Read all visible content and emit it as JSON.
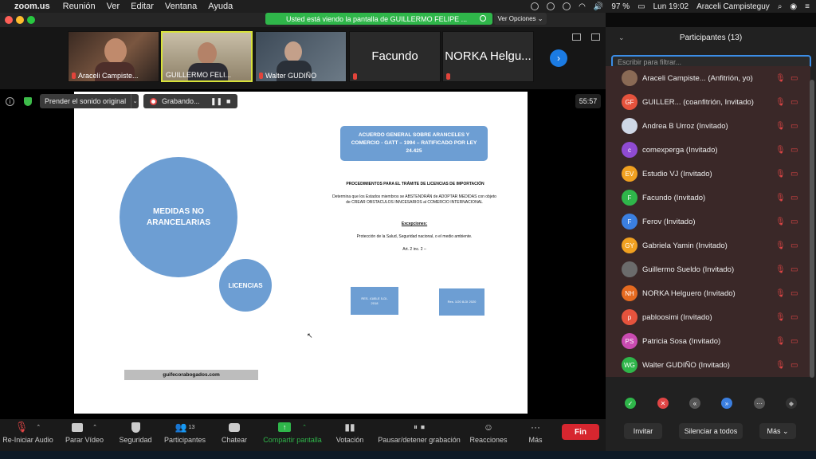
{
  "menubar": {
    "app": "zoom.us",
    "items": [
      "Reunión",
      "Ver",
      "Editar",
      "Ventana",
      "Ayuda"
    ],
    "battery": "97 %",
    "clock": "Lun 19:02",
    "user": "Araceli Campisteguy"
  },
  "share_banner": {
    "text": "Usted está viendo la pantalla de GUILLERMO FELIPE ...",
    "view_options": "Ver Opciones"
  },
  "gallery": [
    {
      "name": "Araceli Campiste..."
    },
    {
      "name": "GUILLERMO FELI..."
    },
    {
      "name": "Walter GUDIÑO"
    },
    {
      "name": "Facundo",
      "big": "Facundo"
    },
    {
      "name": "NORKA Helgu...",
      "big": "NORKA Helgu..."
    }
  ],
  "stage": {
    "original_sound": "Prender el sonido original",
    "recording": "Grabando...",
    "timer": "55:57"
  },
  "slide": {
    "big_circle": "MEDIDAS NO ARANCELARIAS",
    "small_circle": "LICENCIAS",
    "title": "ACUERDO GENERAL SOBRE ARANCELES Y COMERCIO - GATT – 1994 – RATIFICADO POR LEY 24.425",
    "heading": "PROCEDIMIENTOS PARA EL TRÁMITE DE LICENCIAS DE IMPORTACIÓN",
    "body": "Determina que los Estados miembros se ABSTENDRÁN de ADOPTAR MEDIDAS con objeto de CREAR OBSTACULOS INNCESARIOS al COMERCIO INTERNACIONAL",
    "exceptions_label": "Excepciones:",
    "exceptions": "Protección de la Salud, Seguridad nacional, o el medio ambiente.",
    "article": "Art. 2 inc. 2 –",
    "res1": "RES. 4185-E 5-DI-2018",
    "res2": "Res. 1/20 8-DI 2020",
    "url": "guifecorabogados.com"
  },
  "toolbar": {
    "audio": "Re-Iniciar Audio",
    "video": "Parar Vídeo",
    "security": "Seguridad",
    "participants": "Participantes",
    "participants_count": "13",
    "chat": "Chatear",
    "share": "Compartir pantalla",
    "poll": "Votación",
    "record": "Pausar/detener grabación",
    "reactions": "Reacciones",
    "more": "Más",
    "end": "Fin"
  },
  "panel": {
    "title": "Participantes (13)",
    "filter_placeholder": "Escribir para filtrar...",
    "participants": [
      {
        "initials": "",
        "name": "Araceli Campiste... (Anfitrión, yo)",
        "color": "#8a6a55"
      },
      {
        "initials": "GF",
        "name": "GUILLER... (coanfitrión, Invitado)",
        "color": "#e5533d"
      },
      {
        "initials": "",
        "name": "Andrea B Urroz (Invitado)",
        "color": "#cfd8e6"
      },
      {
        "initials": "c",
        "name": "comexperga (Invitado)",
        "color": "#8f4bd1"
      },
      {
        "initials": "EV",
        "name": "Estudio VJ (Invitado)",
        "color": "#f0a020"
      },
      {
        "initials": "F",
        "name": "Facundo (Invitado)",
        "color": "#2fb64a"
      },
      {
        "initials": "F",
        "name": "Ferov (Invitado)",
        "color": "#3b7fe0"
      },
      {
        "initials": "GY",
        "name": "Gabriela Yamin (Invitado)",
        "color": "#f0a020"
      },
      {
        "initials": "",
        "name": "Guillermo Sueldo (Invitado)",
        "color": "#6b6b6b"
      },
      {
        "initials": "NH",
        "name": "NORKA Helguero (Invitado)",
        "color": "#e56a20"
      },
      {
        "initials": "p",
        "name": "pabloosimi (Invitado)",
        "color": "#e5533d"
      },
      {
        "initials": "PS",
        "name": "Patricia Sosa (Invitado)",
        "color": "#c94bb0"
      },
      {
        "initials": "WG",
        "name": "Walter GUDIÑO (Invitado)",
        "color": "#2fb64a"
      }
    ],
    "invite": "Invitar",
    "mute_all": "Silenciar a todos",
    "more": "Más"
  }
}
